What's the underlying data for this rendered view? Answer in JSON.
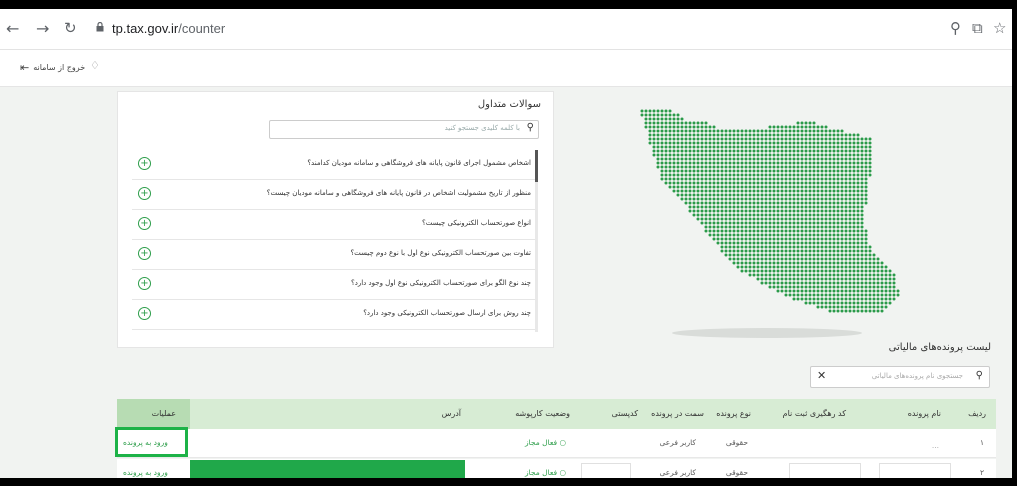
{
  "browser": {
    "url_domain": "tp.tax.gov.ir",
    "url_path": "/counter",
    "icons": [
      "back-icon",
      "forward-icon",
      "reload-icon",
      "lock-icon",
      "zoom-icon",
      "share-icon",
      "star-icon"
    ]
  },
  "header": {
    "logout_label": "خروج از سامانه"
  },
  "faq": {
    "title": "سوالات متداول",
    "search_placeholder": "با کلمه کلیدی جستجو کنید",
    "items": [
      "اشخاص مشمول اجرای قانون پایانه های فروشگاهی و سامانه مودیان کدامند؟",
      "منظور از تاریخ مشمولیت اشخاص در قانون پایانه های فروشگاهی و سامانه مودیان چیست؟",
      "انواع صورتحساب الکترونیکی چیست؟",
      "تفاوت بین صورتحساب الکترونیکی نوع اول با نوع دوم چیست؟",
      "چند نوع الگو برای صورتحساب الکترونیکی نوع اول وجود دارد؟",
      "چند روش برای ارسال صورتحساب الکترونیکی وجود دارد؟"
    ]
  },
  "table": {
    "title": "لیست پرونده‌های مالیاتی",
    "search_placeholder": "جستجوی نام پرونده‌های مالیاتی",
    "headers": {
      "row": "ردیف",
      "name": "نام پرونده",
      "tracking": "کد رهگیری ثبت نام",
      "type": "نوع پرونده",
      "role": "سمت در پرونده",
      "postal": "کدپستی",
      "status": "وضعیت کارپوشه",
      "address": "آدرس",
      "ops": "عملیات"
    },
    "rows": [
      {
        "row": "۱",
        "name": "...",
        "type": "حقوقی",
        "role": "کاربر فرعی",
        "status": "فعال مجاز",
        "action": "ورود به پرونده"
      },
      {
        "row": "۲",
        "name": "",
        "type": "حقوقی",
        "role": "کاربر فرعی",
        "status": "فعال مجاز",
        "action": "ورود به پرونده"
      }
    ]
  },
  "colors": {
    "accent": "#2e9e4b",
    "header_bg": "#d7ecd4",
    "highlight": "#1db247"
  }
}
